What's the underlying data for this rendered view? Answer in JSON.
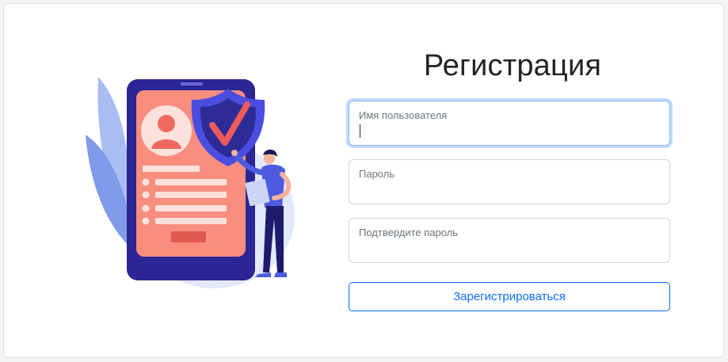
{
  "page": {
    "title": "Регистрация"
  },
  "form": {
    "username": {
      "label": "Имя пользователя",
      "value": ""
    },
    "password": {
      "label": "Пароль",
      "value": ""
    },
    "confirm_password": {
      "label": "Подтвердите пароль",
      "value": ""
    },
    "submit_label": "Зарегистрироваться"
  },
  "colors": {
    "accent": "#0d6efd",
    "illustration_phone": "#2f2596",
    "illustration_screen": "#f78a7c",
    "illustration_shield": "#4c4fe0",
    "illustration_check": "#ef5a5a"
  },
  "illustration": {
    "name": "security-registration-illustration"
  }
}
